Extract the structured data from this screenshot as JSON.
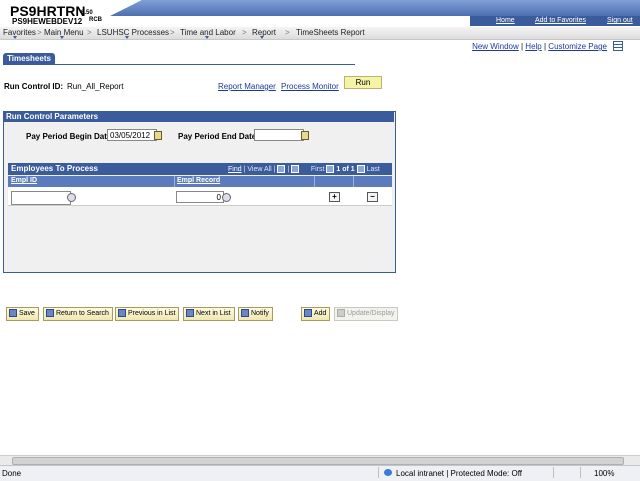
{
  "header": {
    "app_name": "PS9HRTRN",
    "version": "8.50",
    "server": "PS9HEWEBDEV12",
    "user": "RCB",
    "links": [
      "Home",
      "Add to Favorites",
      "Sign out"
    ]
  },
  "nav": {
    "items": [
      "Favorites",
      "Main Menu",
      "LSUHSC Processes",
      "Time and Labor",
      "Report",
      "TimeSheets Report"
    ],
    "separator": ">"
  },
  "page_links": [
    "New Window",
    "Help",
    "Customize Page"
  ],
  "tab": "Timesheets",
  "run_control": {
    "label": "Run Control ID:",
    "value": "Run_All_Report",
    "report_manager": "Report Manager",
    "process_monitor": "Process Monitor",
    "run_button": "Run"
  },
  "params": {
    "title": "Run Control Parameters",
    "begin_label": "Pay Period Begin Date:",
    "begin_value": "03/05/2012",
    "end_label": "Pay Period End Date:",
    "end_value": ""
  },
  "employees": {
    "title": "Employees To Process",
    "find": "Find",
    "view_all": "View All",
    "first": "First",
    "range": "1 of 1",
    "last": "Last",
    "col_emplid": "Empl ID",
    "col_emplrcd": "Empl Record",
    "emplid_value": "",
    "emplrcd_value": "0"
  },
  "toolbar": {
    "save": "Save",
    "return_to_search": "Return to Search",
    "previous_in_list": "Previous in List",
    "next_in_list": "Next in List",
    "notify": "Notify",
    "add": "Add",
    "update_display": "Update/Display"
  },
  "status": {
    "done": "Done",
    "zone": "Local intranet | Protected Mode: Off",
    "zoom": "100%"
  }
}
